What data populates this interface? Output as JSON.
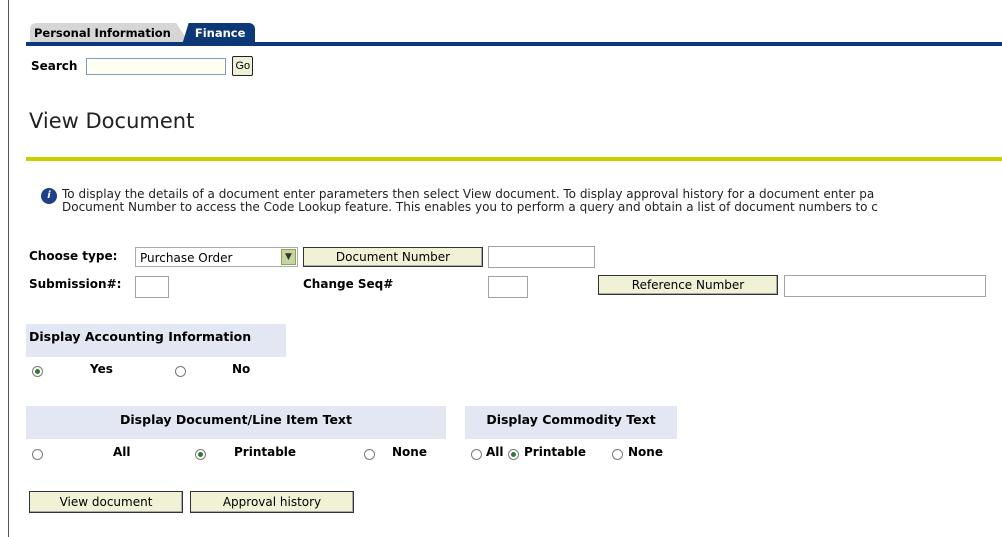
{
  "tabs": [
    {
      "label": "Personal Information",
      "active": false
    },
    {
      "label": "Finance",
      "active": true
    }
  ],
  "search": {
    "label": "Search",
    "value": "",
    "go_label": "Go"
  },
  "page": {
    "title": "View Document"
  },
  "info": {
    "icon": "info-icon",
    "line1": "To display the details of a document enter parameters then select View document. To display approval history for a document enter pa",
    "line2": "Document Number to access the Code Lookup feature. This enables you to perform a query and obtain a list of document numbers to c"
  },
  "form": {
    "choose_type_label": "Choose type:",
    "type_selected": "Purchase Order",
    "document_number_button": "Document Number",
    "document_number_value": "",
    "submission_label": "Submission#:",
    "submission_value": "",
    "change_seq_label": "Change Seq#",
    "change_seq_value": "",
    "reference_number_button": "Reference Number",
    "reference_number_value": ""
  },
  "accounting": {
    "heading": "Display Accounting Information",
    "options": [
      {
        "label": "Yes",
        "checked": true
      },
      {
        "label": "No",
        "checked": false
      }
    ]
  },
  "line_item_text": {
    "heading": "Display Document/Line Item Text",
    "options": [
      {
        "label": "All",
        "checked": false
      },
      {
        "label": "Printable",
        "checked": true
      },
      {
        "label": "None",
        "checked": false
      }
    ]
  },
  "commodity_text": {
    "heading": "Display Commodity Text",
    "options": [
      {
        "label": "All",
        "checked": false
      },
      {
        "label": "Printable",
        "checked": true
      },
      {
        "label": "None",
        "checked": false
      }
    ]
  },
  "actions": {
    "view_document": "View document",
    "approval_history": "Approval history"
  },
  "colors": {
    "tab_active": "#0d3878",
    "title_rule": "#c8d100",
    "section_header": "#e2e7f3"
  }
}
